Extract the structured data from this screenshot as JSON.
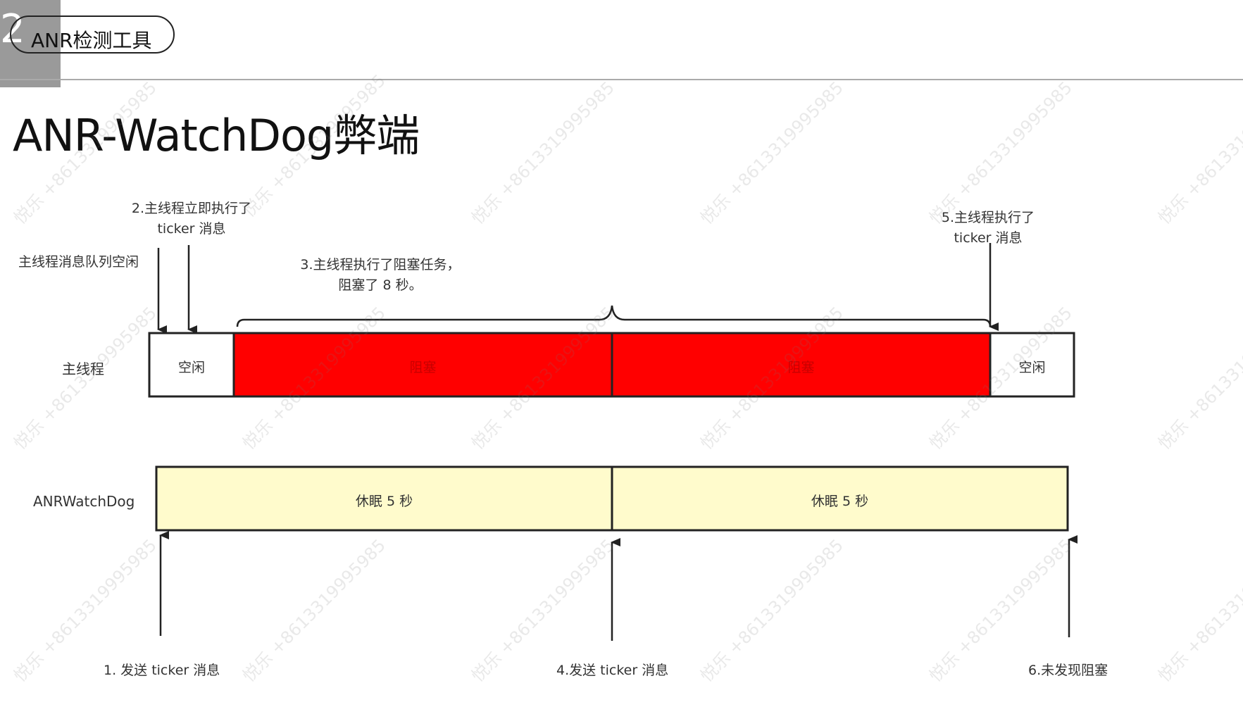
{
  "header": {
    "section_number": "2",
    "section_label": "ANR检测工具"
  },
  "title": "ANR-WatchDog弊端",
  "annotations": {
    "queue_idle": "主线程消息队列空闲",
    "immediate_exec_line1": "2.主线程立即执行了",
    "immediate_exec_line2": "ticker 消息",
    "blocking_task_line1": "3.主线程执行了阻塞任务，",
    "blocking_task_line2": "阻塞了 8 秒。",
    "exec_ticker_line1": "5.主线程执行了",
    "exec_ticker_line2": "ticker 消息"
  },
  "lanes": {
    "main_thread": {
      "label": "主线程",
      "segments": [
        "空闲",
        "阻塞",
        "阻塞",
        "空闲"
      ]
    },
    "watchdog": {
      "label": "ANRWatchDog",
      "segments": [
        "休眠 5 秒",
        "休眠 5 秒"
      ]
    }
  },
  "events": {
    "send_ticker_1": "1. 发送 ticker 消息",
    "send_ticker_4": "4.发送 ticker 消息",
    "no_block_found": "6.未发现阻塞"
  },
  "colors": {
    "block_red": "#ff0000",
    "sleep_yellow": "#fffbcc",
    "idle_white": "#ffffff",
    "stroke": "#222222"
  },
  "watermark": "悦乐 +8613319995985"
}
